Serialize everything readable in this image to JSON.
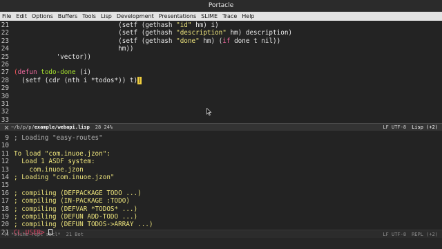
{
  "window": {
    "title": "Portacle"
  },
  "menu": [
    "File",
    "Edit",
    "Options",
    "Buffers",
    "Tools",
    "Lisp",
    "Development",
    "Presentations",
    "SLIME",
    "Trace",
    "Help"
  ],
  "editor": {
    "lines": [
      {
        "n": "21",
        "segs": [
          {
            "t": "                           (setf (gethash ",
            "c": "txt"
          },
          {
            "t": "\"id\"",
            "c": "str"
          },
          {
            "t": " hm) i)",
            "c": "txt"
          }
        ]
      },
      {
        "n": "22",
        "segs": [
          {
            "t": "                           (setf (gethash ",
            "c": "txt"
          },
          {
            "t": "\"description\"",
            "c": "str"
          },
          {
            "t": " hm) description)",
            "c": "txt"
          }
        ]
      },
      {
        "n": "23",
        "segs": [
          {
            "t": "                           (setf (gethash ",
            "c": "txt"
          },
          {
            "t": "\"done\"",
            "c": "str"
          },
          {
            "t": " hm) (",
            "c": "txt"
          },
          {
            "t": "if",
            "c": "kw"
          },
          {
            "t": " done t nil))",
            "c": "txt"
          }
        ]
      },
      {
        "n": "24",
        "segs": [
          {
            "t": "                           hm))",
            "c": "txt"
          }
        ]
      },
      {
        "n": "25",
        "segs": [
          {
            "t": "           'vector))",
            "c": "txt"
          }
        ]
      },
      {
        "n": "26",
        "segs": [
          {
            "t": "",
            "c": "txt"
          }
        ]
      },
      {
        "n": "27",
        "segs": [
          {
            "t": "(",
            "c": "paren-red"
          },
          {
            "t": "defun",
            "c": "kw"
          },
          {
            "t": " ",
            "c": "txt"
          },
          {
            "t": "todo-done",
            "c": "fn"
          },
          {
            "t": " (i)",
            "c": "txt"
          }
        ]
      },
      {
        "n": "28",
        "segs": [
          {
            "t": "  (setf (cdr (nth i *todos*)) t)",
            "c": "txt"
          },
          {
            "t": ")",
            "c": "paren-hl"
          }
        ]
      },
      {
        "n": "29",
        "segs": [
          {
            "t": "",
            "c": "txt"
          }
        ]
      },
      {
        "n": "30",
        "segs": [
          {
            "t": "",
            "c": "txt"
          }
        ]
      },
      {
        "n": "31",
        "segs": [
          {
            "t": "",
            "c": "txt"
          }
        ]
      },
      {
        "n": "32",
        "segs": [
          {
            "t": "",
            "c": "txt"
          }
        ]
      },
      {
        "n": "33",
        "segs": [
          {
            "t": "",
            "c": "txt"
          }
        ]
      }
    ]
  },
  "modeline_top": {
    "path_prefix": "~/b/p/p/",
    "path_dir": "example/",
    "file": "webapi.lisp",
    "position": "28 24%",
    "encoding": "LF UTF-8",
    "mode": "Lisp (+2)"
  },
  "repl": {
    "lines": [
      {
        "n": "9",
        "segs": [
          {
            "t": "; Loading ",
            "c": "cmt"
          },
          {
            "t": "\"easy-routes\"",
            "c": "cmt"
          }
        ]
      },
      {
        "n": "10",
        "segs": [
          {
            "t": "",
            "c": "txt"
          }
        ]
      },
      {
        "n": "11",
        "segs": [
          {
            "t": "To load \"com.inuoe.jzon\":",
            "c": "str"
          }
        ]
      },
      {
        "n": "12",
        "segs": [
          {
            "t": "  Load 1 ASDF system:",
            "c": "str"
          }
        ]
      },
      {
        "n": "13",
        "segs": [
          {
            "t": "    com.inuoe.jzon",
            "c": "str"
          }
        ]
      },
      {
        "n": "14",
        "segs": [
          {
            "t": "; Loading \"com.inuoe.jzon\"",
            "c": "str"
          }
        ]
      },
      {
        "n": "15",
        "segs": [
          {
            "t": "",
            "c": "txt"
          }
        ]
      },
      {
        "n": "16",
        "segs": [
          {
            "t": "; compiling (DEFPACKAGE TODO ...)",
            "c": "str"
          }
        ]
      },
      {
        "n": "17",
        "segs": [
          {
            "t": "; compiling (IN-PACKAGE :TODO)",
            "c": "str"
          }
        ]
      },
      {
        "n": "18",
        "segs": [
          {
            "t": "; compiling (DEFVAR *TODOS* ...)",
            "c": "str"
          }
        ]
      },
      {
        "n": "19",
        "segs": [
          {
            "t": "; compiling (DEFUN ADD-TODO ...)",
            "c": "str"
          }
        ]
      },
      {
        "n": "20",
        "segs": [
          {
            "t": "; compiling (DEFUN TODOS->ARRAY ...)",
            "c": "str"
          }
        ]
      },
      {
        "n": "21",
        "segs": [
          {
            "t": "CL-USER> ",
            "c": "prompt"
          }
        ],
        "cursor": true
      }
    ]
  },
  "modeline_bottom": {
    "buffer": "*slime-repl sbcl*",
    "position": "21 Bot",
    "encoding": "LF UTF-8",
    "mode": "REPL (+2)"
  }
}
